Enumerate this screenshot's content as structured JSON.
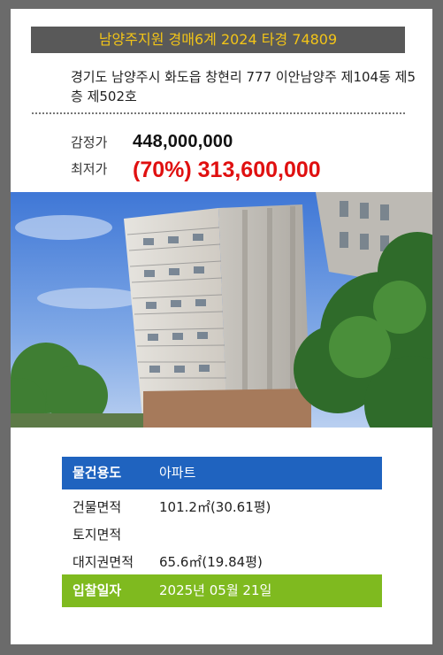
{
  "listing": {
    "title": "남양주지원 경매6계 2024 타경 74809",
    "address": "경기도 남양주시 화도읍 창현리 777 이안남양주 제104동 제5층 제502호",
    "appraisal_label": "감정가",
    "appraisal_value": "448,000,000",
    "minimum_label": "최저가",
    "minimum_value": "(70%) 313,600,000"
  },
  "photo": {
    "subject": "apartment-building-photo"
  },
  "details": [
    {
      "label": "물건용도",
      "value": "아파트"
    },
    {
      "label": "건물면적",
      "value": "101.2㎡(30.61평)"
    },
    {
      "label": "토지면적",
      "value": ""
    },
    {
      "label": "대지권면적",
      "value": "65.6㎡(19.84평)"
    },
    {
      "label": "입찰일자",
      "value": "2025년 05월 21일"
    }
  ],
  "colors": {
    "title_bg": "#595959",
    "title_text": "#f2c418",
    "minimum_price": "#e01010",
    "usage_row": "#1f63bf",
    "bid_date_row": "#7fba1f"
  }
}
